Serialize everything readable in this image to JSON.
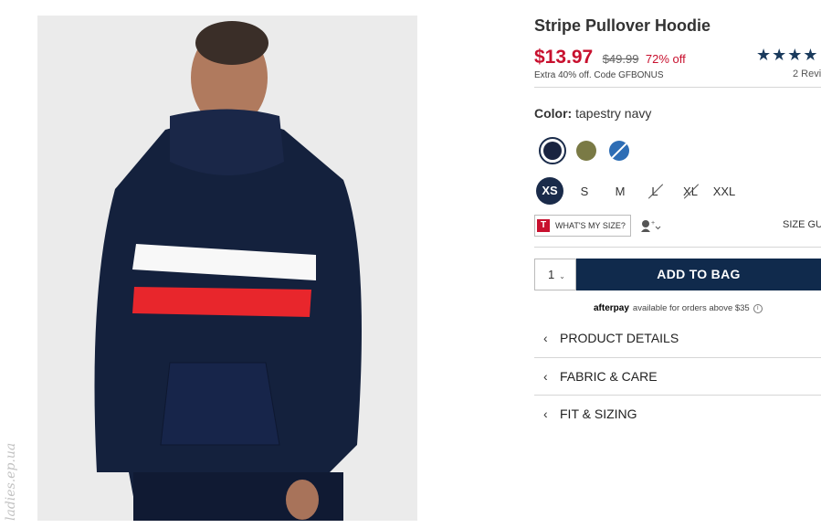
{
  "product": {
    "title": "Stripe Pullover Hoodie",
    "sale_price": "$13.97",
    "original_price": "$49.99",
    "discount": "72% off",
    "promo": "Extra 40% off. Code GFBONUS",
    "rating_stars": "★★★★",
    "reviews": "2 Revi"
  },
  "color": {
    "label": "Color:",
    "value": "tapestry navy",
    "swatches": [
      {
        "name": "tapestry navy",
        "hex": "#1a2440",
        "selected": true
      },
      {
        "name": "olive",
        "hex": "#7a7a45",
        "selected": false
      },
      {
        "name": "blue",
        "hex": "#2d6db5",
        "selected": false,
        "unavailable": true
      }
    ]
  },
  "sizes": [
    {
      "label": "XS",
      "selected": true,
      "available": true
    },
    {
      "label": "S",
      "selected": false,
      "available": true
    },
    {
      "label": "M",
      "selected": false,
      "available": true
    },
    {
      "label": "L",
      "selected": false,
      "available": false
    },
    {
      "label": "XL",
      "selected": false,
      "available": false
    },
    {
      "label": "XXL",
      "selected": false,
      "available": true
    }
  ],
  "fit": {
    "logo": "T",
    "label": "WHAT'S MY SIZE?",
    "size_guide": "SIZE GU"
  },
  "cart": {
    "quantity": "1",
    "add_label": "ADD TO BAG"
  },
  "afterpay": {
    "brand": "afterpay",
    "text": "available for orders above $35",
    "info": "i"
  },
  "accordions": [
    {
      "label": "PRODUCT DETAILS"
    },
    {
      "label": "FABRIC & CARE"
    },
    {
      "label": "FIT & SIZING"
    }
  ],
  "watermark": "ladies.ep.ua",
  "colors": {
    "sale": "#c8102e",
    "navy": "#102a4c",
    "star": "#1a3a5c"
  }
}
